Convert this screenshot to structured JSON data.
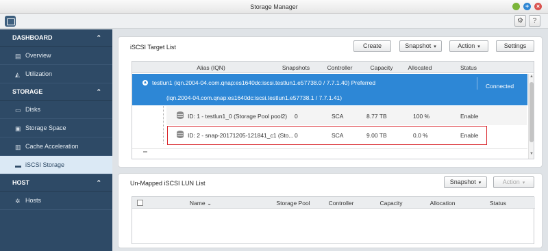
{
  "window": {
    "title": "Storage Manager",
    "min_icon": "●",
    "max_icon": "+",
    "close_icon": "×"
  },
  "toolbar": {
    "gear_glyph": "⚙",
    "help_glyph": "?"
  },
  "sidebar": {
    "dashboard": {
      "label": "DASHBOARD",
      "items": [
        {
          "label": "Overview"
        },
        {
          "label": "Utilization"
        }
      ]
    },
    "storage": {
      "label": "STORAGE",
      "items": [
        {
          "label": "Disks"
        },
        {
          "label": "Storage Space"
        },
        {
          "label": "Cache Acceleration"
        },
        {
          "label": "iSCSI Storage"
        }
      ]
    },
    "host": {
      "label": "HOST",
      "items": [
        {
          "label": "Hosts"
        }
      ]
    },
    "chevron": "⌃"
  },
  "target_panel": {
    "title": "iSCSI Target List",
    "buttons": {
      "create": "Create",
      "snapshot": "Snapshot",
      "action": "Action",
      "settings": "Settings"
    },
    "columns": {
      "alias": "Alias (IQN)",
      "snapshots": "Snapshots",
      "controller": "Controller",
      "capacity": "Capacity",
      "allocated": "Allocated",
      "status": "Status"
    },
    "target": {
      "line1": "testlun1 (iqn.2004-04.com.qnap:es1640dc:iscsi.testlun1.e57738.0 / 7.7.1.40) Preferred",
      "line2": "(iqn.2004-04.com.qnap:es1640dc:iscsi.testlun1.e57738.1 / 7.7.1.41)",
      "status": "Connected"
    },
    "luns": [
      {
        "id": "ID: 1 - testlun1_0 (Storage Pool pool2)",
        "snapshots": "0",
        "controller": "SCA",
        "capacity": "8.77 TB",
        "allocated": "100 %",
        "status": "Enable"
      },
      {
        "id": "ID: 2 - snap-20171205-121841_c1 (Sto...",
        "snapshots": "0",
        "controller": "SCA",
        "capacity": "9.00 TB",
        "allocated": "0.0 %",
        "status": "Enable"
      }
    ]
  },
  "unmapped_panel": {
    "title": "Un-Mapped iSCSI LUN List",
    "buttons": {
      "snapshot": "Snapshot",
      "action": "Action"
    },
    "columns": {
      "name": "Name",
      "sort": "⌄",
      "pool": "Storage Pool",
      "controller": "Controller",
      "capacity": "Capacity",
      "allocation": "Allocation",
      "status": "Status"
    }
  },
  "colors": {
    "accent": "#2d87d6",
    "sidebar": "#2e4a66",
    "highlight": "#d9262c"
  }
}
